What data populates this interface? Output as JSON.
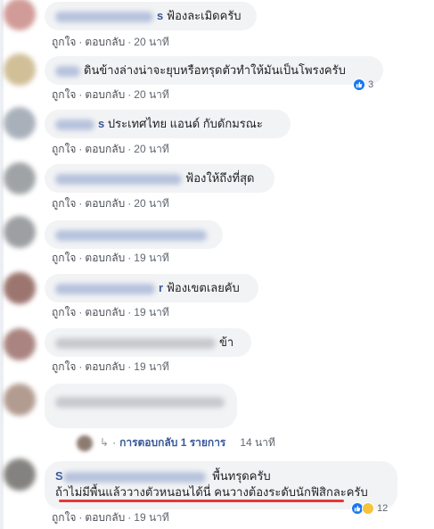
{
  "comments": [
    {
      "text": "ฟ้องละเมิดครับ",
      "name_tail": "s",
      "like": "ถูกใจ",
      "reply": "ตอบกลับ",
      "time": "20 นาที",
      "avatar_color": "#c98a86"
    },
    {
      "text": "ดินข้างล่างน่าจะยุบหรือทรุดตัวทำให้มันเป็นโพรงครับ",
      "name_tail": "",
      "like": "ถูกใจ",
      "reply": "ตอบกลับ",
      "time": "20 นาที",
      "reaction_count": "3",
      "avatar_color": "#c9b487"
    },
    {
      "text": "ประเทศไทย แอนด์ กับดักมรณะ",
      "name_tail": "s",
      "like": "ถูกใจ",
      "reply": "ตอบกลับ",
      "time": "20 นาที",
      "avatar_color": "#9aa3ae"
    },
    {
      "text": "ฟ้องให้ถึงที่สุด",
      "name_tail": "",
      "like": "ถูกใจ",
      "reply": "ตอบกลับ",
      "time": "20 นาที",
      "avatar_color": "#8f9497"
    },
    {
      "text": "",
      "name_tail": "",
      "like": "ถูกใจ",
      "reply": "ตอบกลับ",
      "time": "19 นาที",
      "avatar_color": "#8c8f93"
    },
    {
      "text": "ฟ้องเขตเลยคับ",
      "name_tail": "r",
      "like": "ถูกใจ",
      "reply": "ตอบกลับ",
      "time": "19 นาที",
      "avatar_color": "#8b5e57"
    },
    {
      "text": "ข้า",
      "name_tail": "",
      "like": "ถูกใจ",
      "reply": "ตอบกลับ",
      "time": "19 นาที",
      "avatar_color": "#9b6f6a"
    },
    {
      "text": "",
      "name_tail": "",
      "avatar_color": "#a58b7e"
    },
    {
      "line1": "พื้นทรุดครับ",
      "line2": "ถ้าไม่มีพื้นแล้ววางตัวหนอนได้นี่ คนวางต้องระดับนักฟิสิกละครับ",
      "name_head": "S",
      "like": "ถูกใจ",
      "reply": "ตอบกลับ",
      "time": "19 นาที",
      "reaction_count": "12",
      "avatar_color": "#6f6d6a"
    }
  ],
  "reply_thread": {
    "link": "การตอบกลับ 1 รายการ",
    "time": "14 นาที"
  },
  "colors": {
    "bubble": "#f2f3f5",
    "link_blue": "#385898",
    "like_blue": "#1877f2",
    "highlight_red": "#e53935"
  }
}
